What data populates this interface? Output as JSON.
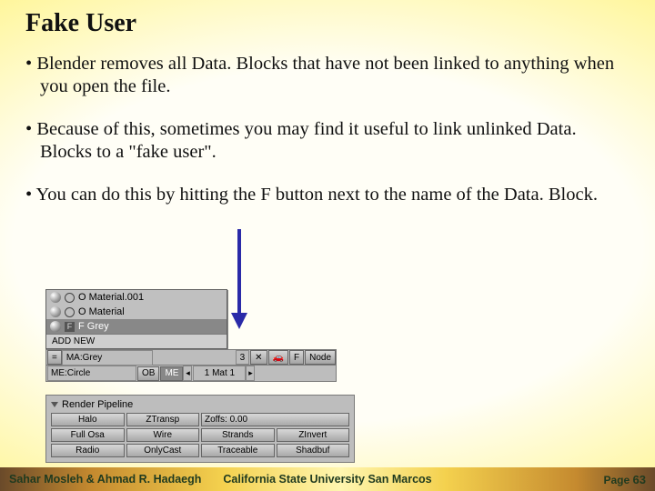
{
  "title": "Fake User",
  "bullets": [
    "Blender removes all Data. Blocks that have not been linked to anything when you open the file.",
    "Because of this, sometimes you may find it useful to link unlinked Data. Blocks to a \"fake user\".",
    "You can do this by hitting the F button next to the name of the Data. Block."
  ],
  "dropdown": {
    "items": [
      {
        "prefix": "O",
        "label": "Material.001"
      },
      {
        "prefix": "O",
        "label": "Material"
      },
      {
        "prefix": "F",
        "label": "Grey"
      }
    ],
    "add_new": "ADD NEW"
  },
  "matbar": {
    "up": "=",
    "name_prefix": "MA:",
    "name": "Grey",
    "count": "3",
    "x": "✕",
    "f": "F",
    "nodes": "Node"
  },
  "mebar": {
    "me_prefix": "ME:",
    "me_name": "Circle",
    "ob": "OB",
    "me": "ME",
    "left": "◂",
    "matlabel": "1 Mat 1",
    "right": "▸"
  },
  "render": {
    "title": "Render Pipeline",
    "buttons": [
      "Halo",
      "ZTransp",
      "Zoffs: 0.00",
      "Full Osa",
      "Wire",
      "Strands",
      "ZInvert",
      "Radio",
      "OnlyCast",
      "Traceable",
      "Shadbuf"
    ]
  },
  "footer": {
    "left": "Sahar Mosleh & Ahmad R. Hadaegh",
    "mid": "California State University San Marcos",
    "page_label": "Page",
    "page_num": "63"
  }
}
